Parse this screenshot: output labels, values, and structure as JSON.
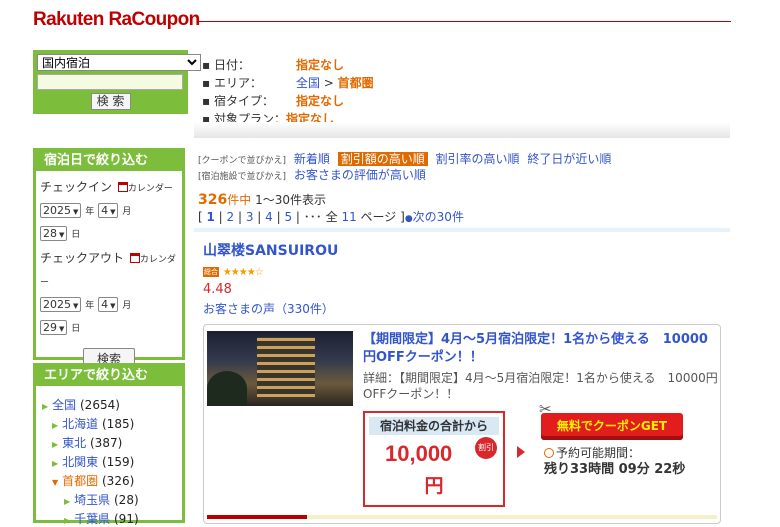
{
  "header": {
    "logo": "Rakuten RaCoupon"
  },
  "search": {
    "category_selected": "国内宿泊",
    "keyword_value": "",
    "search_button": "検 索"
  },
  "conditions": [
    {
      "key": "日付：",
      "value": "指定なし"
    },
    {
      "key": "エリア：",
      "link": "全国",
      "sep": " > ",
      "value": "首都圏"
    },
    {
      "key": "宿タイプ：",
      "value": "指定なし"
    },
    {
      "key": "対象プラン：",
      "value": "指定なし"
    }
  ],
  "sort": {
    "coupon_prefix": "[クーポンで並びかえ]",
    "coupon_options": [
      "新着順",
      "割引額の高い順",
      "割引率の高い順",
      "終了日が近い順"
    ],
    "active": "割引額の高い順",
    "facility_prefix": "[宿泊施設で並びかえ]",
    "facility_option": "お客さまの評価が高い順"
  },
  "results": {
    "count": "326",
    "count_suffix": "件中",
    "range": "1〜30件表示",
    "pages": [
      "1",
      "2",
      "3",
      "4",
      "5"
    ],
    "ellipsis": "･･･ 全",
    "total_pages": "11",
    "pages_suffix": "ページ ]",
    "next": "次の30件"
  },
  "date_filter": {
    "title": "宿泊日で絞り込む",
    "checkin_label": "チェックイン",
    "checkout_label": "チェックアウト",
    "calendar_label": "カレンダー",
    "checkin": {
      "year": "2025",
      "month": "4",
      "day": "28"
    },
    "checkout": {
      "year": "2025",
      "month": "4",
      "day": "29"
    },
    "year_unit": "年",
    "month_unit": "月",
    "day_unit": "日",
    "search_button": "検索"
  },
  "area_filter": {
    "title": "エリアで絞り込む",
    "items": [
      {
        "label": "全国",
        "count": "(2654)"
      },
      {
        "label": "北海道",
        "count": "(185)"
      },
      {
        "label": "東北",
        "count": "(387)"
      },
      {
        "label": "北関東",
        "count": "(159)"
      },
      {
        "label": "首都圏",
        "count": "(326)"
      },
      {
        "label": "埼玉県",
        "count": "(28)"
      },
      {
        "label": "千葉県",
        "count": "(91)"
      }
    ]
  },
  "hotel": {
    "name": "山翠楼SANSUIROU",
    "rating_badge": "総合",
    "rating": "4.48",
    "stars": 4.5,
    "reviews": "お客さまの声（330件）"
  },
  "coupon": {
    "title": "【期間限定】4月〜5月宿泊限定！1名から使える　10000円OFFクーポン！！",
    "detail": "詳細：【期間限定】4月〜5月宿泊限定！1名から使える　10000円OFFクーポン！！",
    "price_label": "宿泊料金の合計から",
    "amount": "10,000",
    "yen": "円",
    "discount_badge": "割引",
    "get_button": "無料でクーポンGET",
    "period_label": "予約可能期間：",
    "remaining": "残り33時間 09分 22秒"
  },
  "colors": {
    "brand": "#bf0000",
    "green": "#7cbd3b",
    "link": "#3355cc",
    "orange": "#e06a00",
    "red": "#d9282b"
  }
}
